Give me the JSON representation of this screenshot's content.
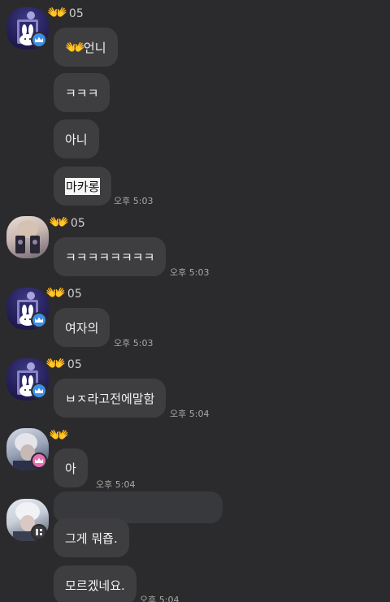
{
  "messages": [
    {
      "nick": "05",
      "hands": "👐"
    },
    {
      "lines": [
        "언니",
        "ㅋㅋㅋ",
        "아니",
        "마카롱"
      ],
      "time": "오후 5:03"
    },
    {
      "nick": "05",
      "hands": "👐",
      "text": "ㅋㅋㅋㅋㅋㅋㅋㅋ",
      "time": "오후 5:03"
    },
    {
      "nick": "05",
      "hands": "👐",
      "text": "여자의",
      "time": "오후 5:03"
    },
    {
      "nick": "05",
      "hands": "👐",
      "text": "ㅂㅈ라고전에말함",
      "time": "오후 5:04"
    },
    {
      "hands": "👐",
      "text": "아",
      "time": "오후 5:04"
    },
    {
      "lines": [
        "그게 뭐죱.",
        "모르겠네요."
      ],
      "time": "오후 5:04"
    }
  ],
  "badges": {
    "creator": "crown-icon",
    "member": "crown-icon",
    "bot": "bot-icon"
  },
  "colors": {
    "background": "#2b2b2d",
    "bubble": "#3e3e40",
    "blue_badge": "#3d8fe8",
    "pink_badge": "#e86fb6"
  }
}
